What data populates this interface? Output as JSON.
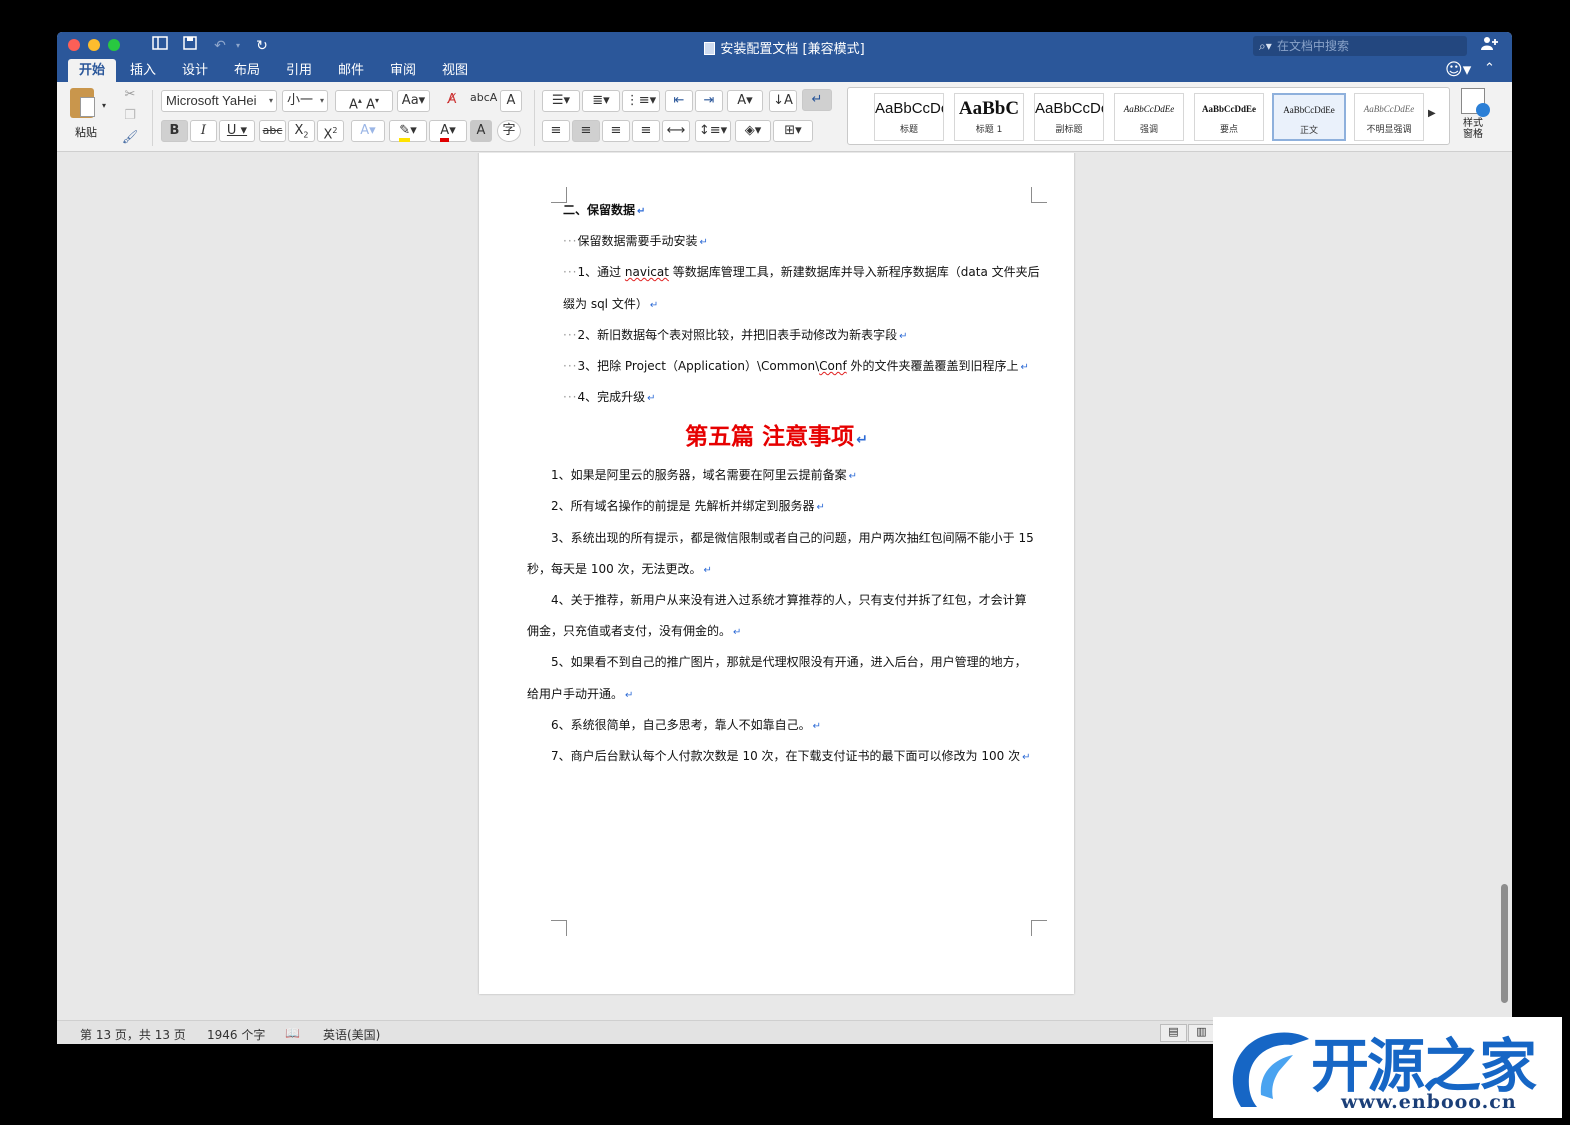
{
  "window": {
    "title": "安装配置文档 [兼容模式]",
    "search_placeholder": "在文档中搜索"
  },
  "tabs": [
    "开始",
    "插入",
    "设计",
    "布局",
    "引用",
    "邮件",
    "审阅",
    "视图"
  ],
  "ribbon": {
    "paste_label": "粘贴",
    "font_name": "Microsoft YaHei",
    "font_size": "小一",
    "styles": [
      {
        "sample": "AaBbCcDc",
        "name": "标题"
      },
      {
        "sample": "AaBbC",
        "name": "标题 1"
      },
      {
        "sample": "AaBbCcDc",
        "name": "副标题"
      },
      {
        "sample": "AaBbCcDdEe",
        "name": "强调"
      },
      {
        "sample": "AaBbCcDdEe",
        "name": "要点"
      },
      {
        "sample": "AaBbCcDdEe",
        "name": "正文"
      },
      {
        "sample": "AaBbCcDdEe",
        "name": "不明显强调"
      }
    ],
    "style_pane_label": "样式\n窗格"
  },
  "document": {
    "section_heading": "二、保留数据",
    "para1": "保留数据需要手动安装",
    "step1_a": "1、通过 ",
    "step1_navicat": "navicat",
    "step1_b": " 等数据库管理工具，新建数据库并导入新程序数据库（data 文件夹后",
    "step1_c": "缀为 sql 文件）",
    "step2": "2、新旧数据每个表对照比较，并把旧表手动修改为新表字段",
    "step3_a": "3、把除 Project（Application）\\Common\\",
    "step3_conf": "Conf",
    "step3_b": " 外的文件夹覆盖覆盖到旧程序上",
    "step4": "4、完成升级",
    "chapter_title": "第五篇  注意事项",
    "notes": [
      "1、如果是阿里云的服务器，域名需要在阿里云提前备案",
      "2、所有域名操作的前提是  先解析并绑定到服务器",
      "3、系统出现的所有提示，都是微信限制或者自己的问题，用户两次抽红包间隔不能小于 15",
      "秒，每天是 100 次，无法更改。",
      "4、关于推荐，新用户从来没有进入过系统才算推荐的人，只有支付并拆了红包，才会计算",
      "佣金，只充值或者支付，没有佣金的。",
      "5、如果看不到自己的推广图片，那就是代理权限没有开通，进入后台，用户管理的地方，",
      "给用户手动开通。",
      "6、系统很简单，自己多思考，靠人不如靠自己。",
      "7、商户后台默认每个人付款次数是 10 次，在下载支付证书的最下面可以修改为 100 次"
    ],
    "paragraph_mark": "↵"
  },
  "statusbar": {
    "page": "第 13 页，共 13 页",
    "words": "1946 个字",
    "language": "英语(美国)"
  },
  "watermark": {
    "brand": "开源之家",
    "url": "www.enbooo.cn"
  },
  "colors": {
    "titlebar": "#2b579a",
    "heading_red": "#e60000",
    "para_mark": "#2d6bd6"
  }
}
